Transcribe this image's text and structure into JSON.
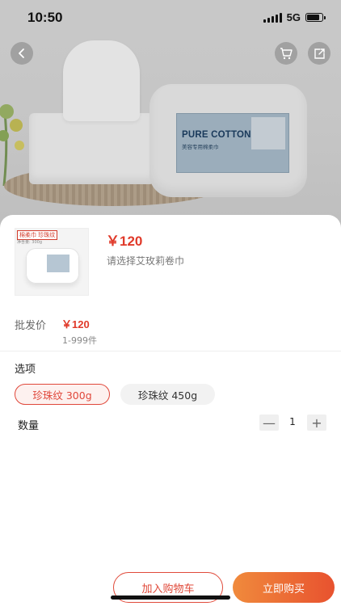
{
  "status_bar": {
    "time": "10:50",
    "network": "5G"
  },
  "hero": {
    "label_title": "PURE COTTON",
    "label_subtitle": "美容专用棉柔巾",
    "icons": [
      "back-icon",
      "cart-icon",
      "share-icon"
    ]
  },
  "product": {
    "thumb_tag": "棉柔巾 珍珠纹",
    "thumb_sub": "净含量: 300g",
    "price": "￥120",
    "hint": "请选择艾玫莉卷巾"
  },
  "wholesale": {
    "label": "批发价",
    "price": "￥120",
    "range": "1-999件"
  },
  "options": {
    "title": "选项",
    "choices": [
      {
        "label": "珍珠纹 300g",
        "selected": true
      },
      {
        "label": "珍珠纹 450g",
        "selected": false
      }
    ]
  },
  "quantity": {
    "label": "数量",
    "value": "1",
    "minus": "—",
    "plus": "+"
  },
  "actions": {
    "add_to_cart": "加入购物车",
    "buy_now": "立即购买"
  },
  "colors": {
    "accent": "#e03a2a",
    "buy_gradient_start": "#f08a3c",
    "buy_gradient_end": "#e8522f"
  }
}
